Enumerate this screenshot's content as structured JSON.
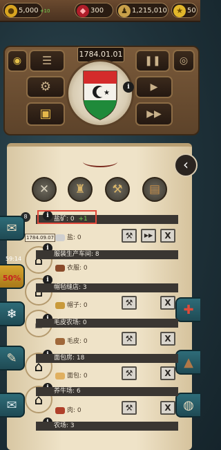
{
  "resources": {
    "gold": {
      "value": "5,000",
      "plus": "+10"
    },
    "gems": {
      "value": "300"
    },
    "population": {
      "value": "1,215,010"
    },
    "stars": {
      "value": "50"
    }
  },
  "controls": {
    "date": "1784.01.01",
    "pause_icon": "pause-icon",
    "play_icon": "play-icon",
    "fast_icon": "fast-forward-icon"
  },
  "nation": {
    "colors": {
      "red": "#d42b2b",
      "white": "#f4f1ea",
      "green": "#1f8a3a"
    }
  },
  "left_badge": {
    "count": "8",
    "date": "1784.09.07",
    "timer": "59:14",
    "sale": "50%"
  },
  "buildings": [
    {
      "name": "盐矿: 0",
      "plus": "+1",
      "product": "盐: 0"
    },
    {
      "name": "服装生产车间: 8",
      "product": "衣服: 0"
    },
    {
      "name": "帽毡缝店: 3",
      "product": "帽子: 0"
    },
    {
      "name": "毛皮农场: 0",
      "product": "毛皮: 0"
    },
    {
      "name": "面包房: 18",
      "product": "面包: 0"
    },
    {
      "name": "养牛场: 6",
      "product": "肉: 0"
    },
    {
      "name": "农场: 3",
      "product": ""
    }
  ],
  "action_labels": {
    "build": "⚒",
    "fast": "▶▶",
    "close": "X"
  },
  "highlight_color": "#e0483a"
}
